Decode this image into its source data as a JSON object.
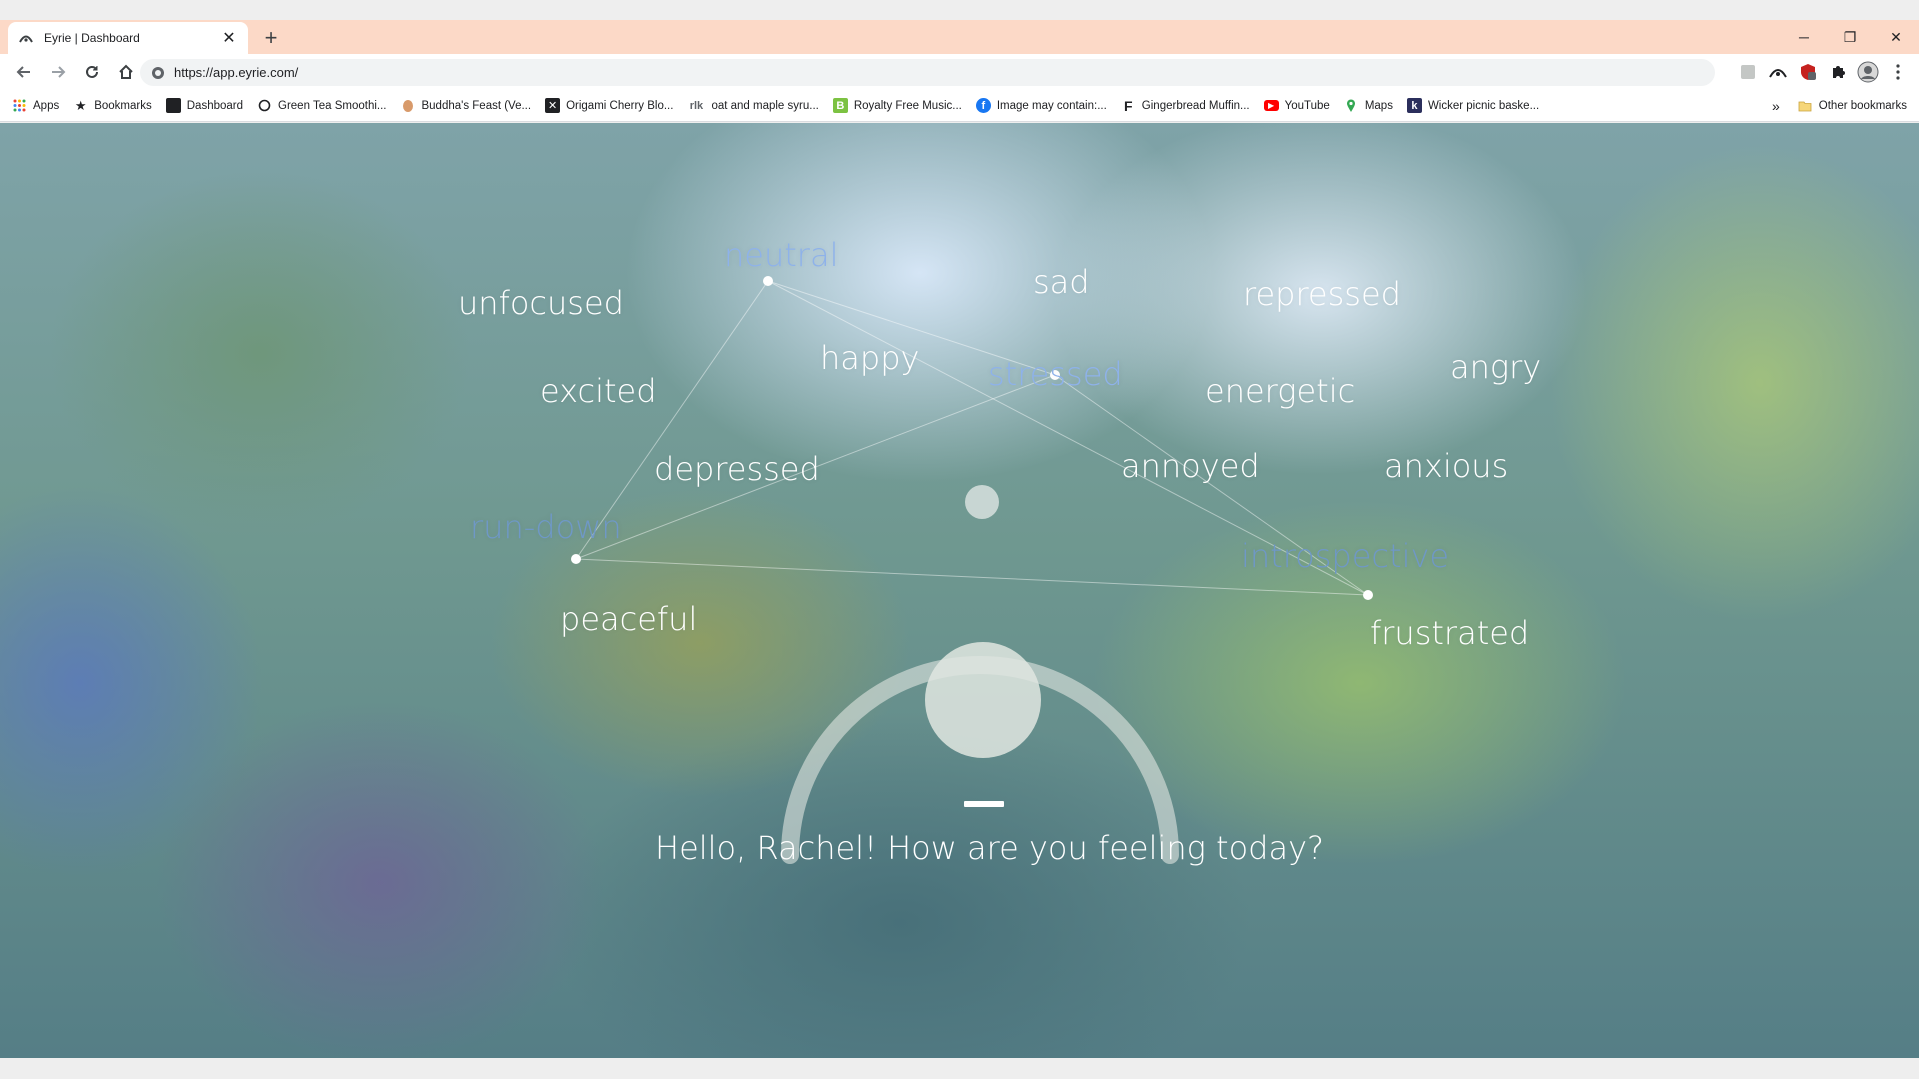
{
  "browser": {
    "tab": {
      "title": "Eyrie | Dashboard",
      "close": "✕"
    },
    "new_tab": "+",
    "window_controls": {
      "minimize": "─",
      "restore": "❐",
      "close": "✕"
    },
    "address": {
      "url": "https://app.eyrie.com/"
    },
    "bookmarks": [
      {
        "label": "Apps",
        "icon": "apps-grid-icon"
      },
      {
        "label": "Bookmarks",
        "icon": "star-icon"
      },
      {
        "label": "Dashboard",
        "icon": "dashboard-icon"
      },
      {
        "label": "Green Tea Smoothi...",
        "icon": "leaf-icon"
      },
      {
        "label": "Buddha's Feast (Ve...",
        "icon": "bowl-icon"
      },
      {
        "label": "Origami Cherry Blo...",
        "icon": "origami-icon"
      },
      {
        "label": "oat and maple syru...",
        "icon": "text-logo-icon"
      },
      {
        "label": "Royalty Free Music...",
        "icon": "music-icon"
      },
      {
        "label": "Image may contain:...",
        "icon": "facebook-icon"
      },
      {
        "label": "Gingerbread Muffin...",
        "icon": "f-logo-icon"
      },
      {
        "label": "YouTube",
        "icon": "youtube-icon"
      },
      {
        "label": "Maps",
        "icon": "maps-pin-icon"
      },
      {
        "label": "Wicker picnic baske...",
        "icon": "k-logo-icon"
      }
    ],
    "bookmarks_overflow": "»",
    "other_bookmarks": "Other bookmarks"
  },
  "app": {
    "moods": {
      "neutral": "neutral",
      "sad": "sad",
      "repressed": "repressed",
      "unfocused": "unfocused",
      "happy": "happy",
      "stressed": "stressed",
      "angry": "angry",
      "excited": "excited",
      "energetic": "energetic",
      "depressed": "depressed",
      "annoyed": "annoyed",
      "anxious": "anxious",
      "run_down": "run-down",
      "introspective": "introspective",
      "peaceful": "peaceful",
      "frustrated": "frustrated"
    },
    "selected_moods": [
      "neutral",
      "stressed",
      "run-down",
      "introspective"
    ],
    "greeting": "Hello, Rachel! How are you feeling today?",
    "colors": {
      "selected_light": "#8eb2ea",
      "selected_dark": "#6f98c7",
      "tab_strip": "#fcd9c7"
    }
  }
}
